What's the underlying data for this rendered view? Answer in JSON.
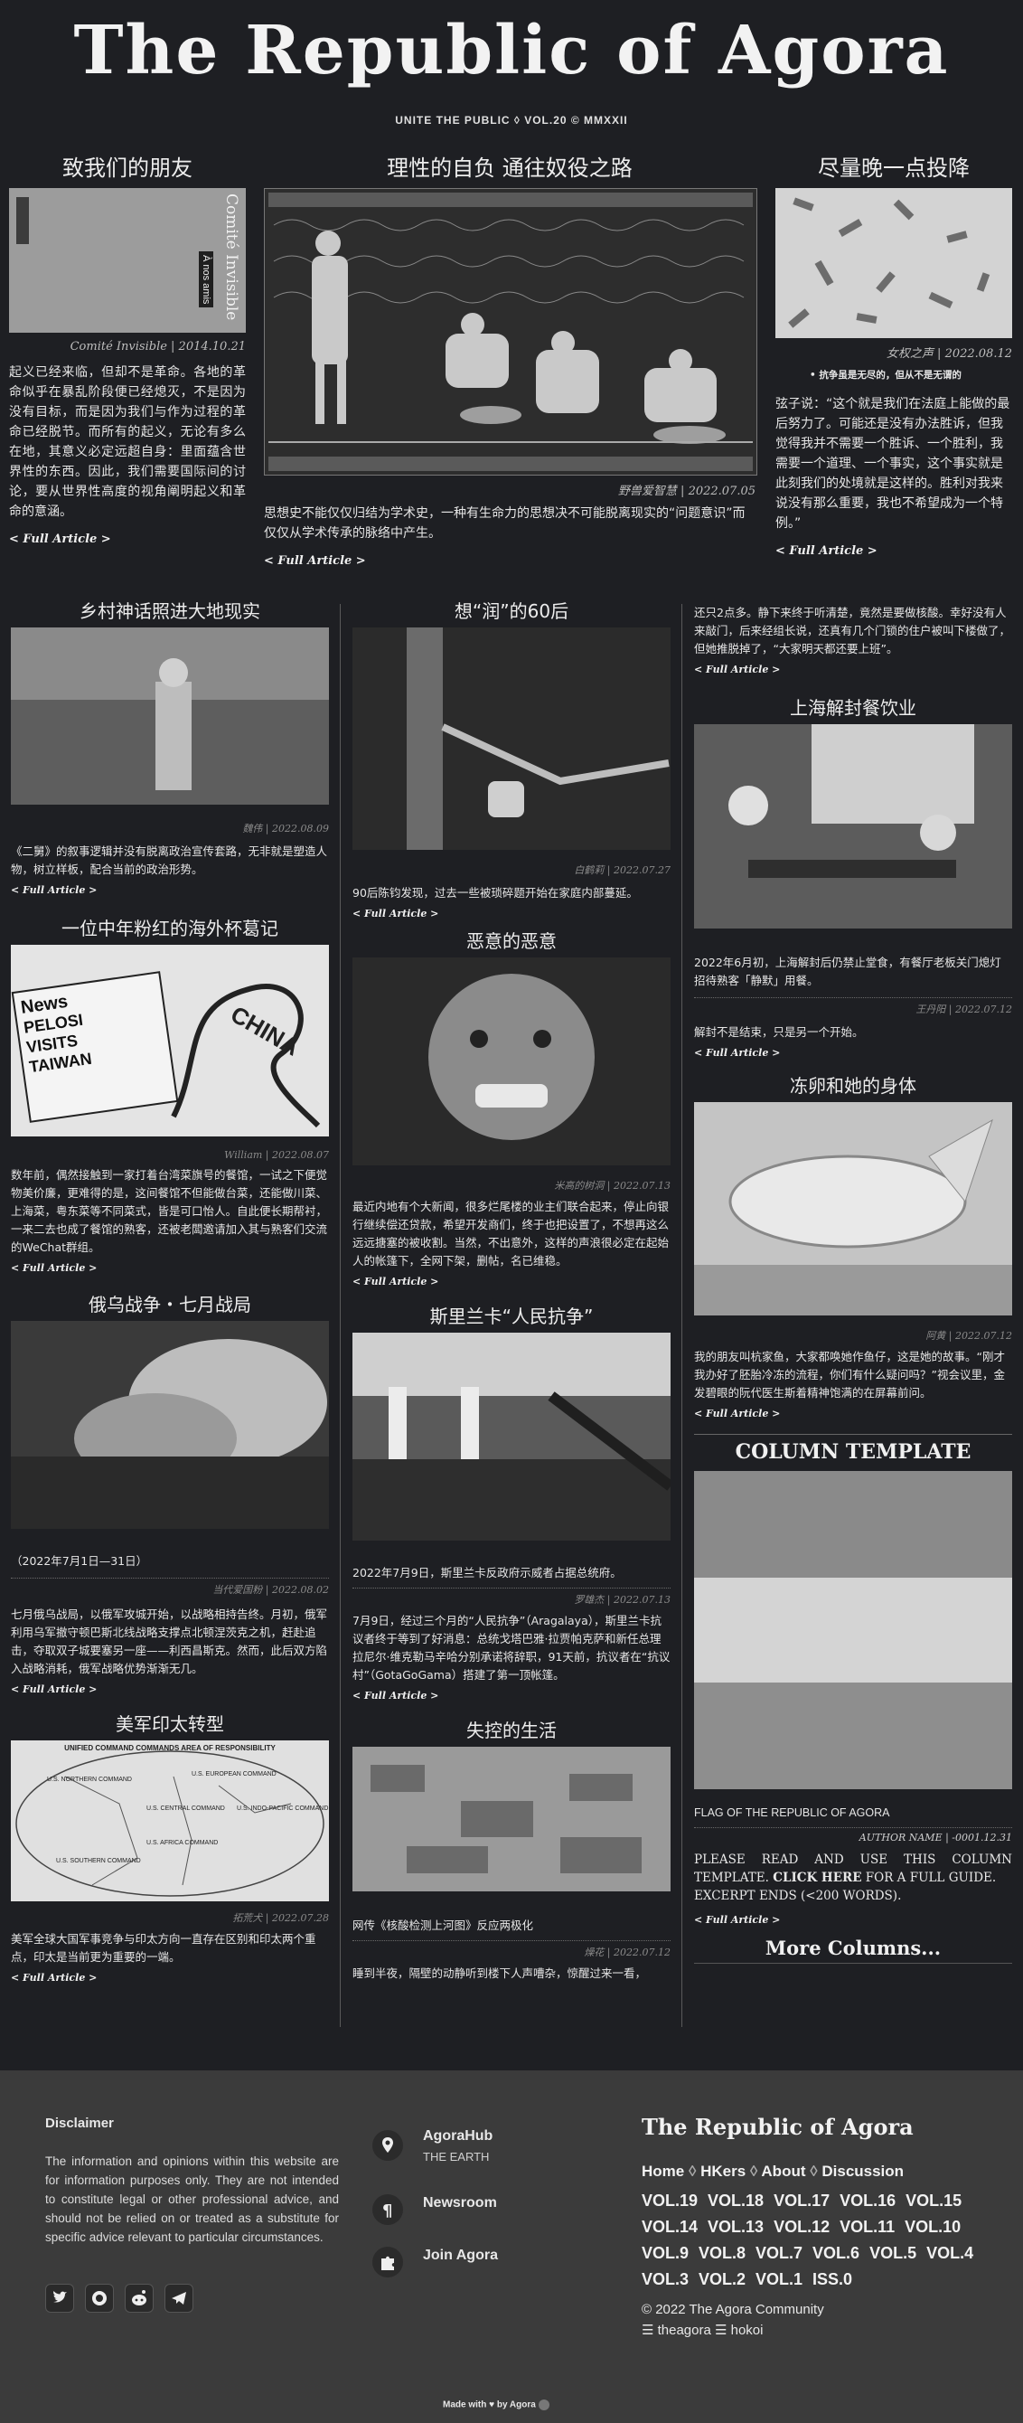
{
  "masthead": {
    "title": "The Republic of Agora",
    "subtitle": "UNITE THE PUBLIC ◊ VOL.20 © MMXXII"
  },
  "top": {
    "left": {
      "title": "致我们的朋友",
      "byline": "Comité Invisible | 2014.10.21",
      "body": "起义已经来临，但却不是革命。各地的革命似乎在暴乱阶段便已经熄灭，不是因为没有目标，而是因为我们与作为过程的革命已经脱节。而所有的起义，无论有多么在地，其意义必定远超自身：里面蕴含世界性的东西。因此，我们需要国际间的讨论，要从世界性高度的视角阐明起义和革命的意涵。",
      "cover_title": "Comité Invisible",
      "cover_small": "À nos amis"
    },
    "center": {
      "title": "理性的自负 通往奴役之路",
      "byline": "野兽爱智慧 | 2022.07.05",
      "body": "思想史不能仅仅归结为学术史，一种有生命力的思想决不可能脱离现实的“问题意识”而仅仅从学术传承的脉络中产生。"
    },
    "right": {
      "title": "尽量晚一点投降",
      "byline": "女权之声 | 2022.08.12",
      "bullet": "抗争虽是无尽的，但从不是无谓的",
      "body": "弦子说：“这个就是我们在法庭上能做的最后努力了。可能还是没有办法胜诉，但我觉得我并不需要一个胜诉、一个胜利，我需要一个道理、一个事实，这个事实就是此刻我们的处境就是这样的。胜利对我来说没有那么重要，我也不希望成为一个特例。”"
    },
    "more": "< Full Article >"
  },
  "col1": [
    {
      "title": "乡村神话照进大地现实",
      "byline": "魏伟 | 2022.08.09",
      "body": "《二舅》的叙事逻辑并没有脱离政治宣传套路，无非就是塑造人物，树立样板，配合当前的政治形势。"
    },
    {
      "title": "一位中年粉红的海外杯葛记",
      "byline": "William | 2022.08.07",
      "body": "数年前，偶然接触到一家打着台湾菜旗号的餐馆，一试之下便觉物美价廉，更难得的是，这间餐馆不但能做台菜，还能做川菜、上海菜，粤东菜等不同菜式，皆是可口怡人。自此便长期帮衬，一来二去也成了餐馆的熟客，还被老闆邀请加入其与熟客们交流的WeChat群组。",
      "news_a": "PELOSI",
      "news_b": "VISITS",
      "news_c": "TAIWAN",
      "news_d": "News",
      "news_e": "CHINA"
    },
    {
      "title": "俄乌战争・七月战局",
      "date_note": "（2022年7月1日—31日）",
      "byline": "当代爱国粉 | 2022.08.02",
      "body": "七月俄乌战局，以俄军攻城开始，以战略相持告终。月初，俄军利用乌军撤守顿巴斯北线战略支撑点北顿涅茨克之机，赶赴追击，夺取双子城要塞另一座——利西昌斯克。然而，此后双方陷入战略消耗，俄军战略优势渐渐无几。"
    },
    {
      "title": "美军印太转型",
      "byline": "拓荒犬 | 2022.07.28",
      "body": "美军全球大国军事竞争与印太方向一直存在区别和印太两个重点，印太是当前更为重要的一端。",
      "map_title": "UNIFIED COMMAND COMMANDS AREA OF RESPONSIBILITY",
      "map_labels": [
        "U.S. NORTHERN COMMAND",
        "U.S. EUROPEAN COMMAND",
        "U.S. INDO-PACIFIC COMMAND",
        "U.S. CENTRAL COMMAND",
        "U.S. AFRICA COMMAND",
        "U.S. SOUTHERN COMMAND"
      ]
    }
  ],
  "col2": [
    {
      "title": "想“润”的60后",
      "byline": "白鹤莉 | 2022.07.27",
      "body": "90后陈钧发现，过去一些被琐碎题开始在家庭内部蔓延。"
    },
    {
      "title": "恶意的恶意",
      "byline": "米高的树洞 | 2022.07.13",
      "body": "最近内地有个大新闻，很多烂尾楼的业主们联合起来，停止向银行继续偿还贷款，希望开发商们，终于也把设置了，不想再这么远远搪塞的被收割。当然，不出意外，这样的声浪很必定在起始人的帐篷下，全网下架，删帖，名已维稳。"
    },
    {
      "title": "斯里兰卡“人民抗争”",
      "lead": "2022年7月9日，斯里兰卡反政府示威者占据总统府。",
      "byline": "罗雄杰 | 2022.07.13",
      "body": "7月9日，经过三个月的“人民抗争”（Aragalaya），斯里兰卡抗议者终于等到了好消息：总统戈塔巴雅·拉贾帕克萨和新任总理拉尼尔·维克勒马辛哈分别承诺将辞职，91天前，抗议者在“抗议村”（GotaGoGama）搭建了第一顶帐篷。"
    },
    {
      "title": "失控的生活",
      "lead": "网传《核酸检测上河图》反应两极化",
      "byline": "燥花 | 2022.07.12",
      "body": "睡到半夜，隔壁的动静听到楼下人声嘈杂，惊醒过来一看，"
    }
  ],
  "col3": [
    {
      "title": "",
      "byline": "",
      "body": "还只2点多。静下来终于听清楚，竟然是要做核酸。幸好没有人来敲门，后来经组长说，还真有几个门锁的住户被叫下楼做了，但她推脱掉了，“大家明天都还要上班”。"
    },
    {
      "title": "上海解封餐饮业",
      "body": "2022年6月初，上海解封后仍禁止堂食，有餐厅老板关门熄灯招待熟客「静默」用餐。",
      "byline": "王丹阳 | 2022.07.12",
      "body2": "解封不是结束，只是另一个开始。"
    },
    {
      "title": "冻卵和她的身体",
      "byline": "阿黄 | 2022.07.12",
      "body": "我的朋友叫杭家鱼，大家都唤她作鱼仔，这是她的故事。“刚才我办好了胚胎冷冻的流程，你们有什么疑问吗？”视会议里，金发碧眼的阮代医生斯着精神饱满的在屏幕前问。"
    }
  ],
  "template": {
    "title": "COLUMN TEMPLATE",
    "caption": "FLAG OF THE REPUBLIC OF AGORA",
    "byline": "AUTHOR NAME | -0001.12.31",
    "text_a": "PLEASE READ AND USE THIS COLUMN TEMPLATE.",
    "text_b": "CLICK HERE",
    "text_c": "FOR A FULL GUIDE.",
    "text_d": "EXCERPT ENDS (<200 WORDS).",
    "more_columns": "More Columns...",
    "flag_colors": [
      "#8a8a8a",
      "#d4d4d4",
      "#8e8e8e"
    ]
  },
  "footer": {
    "disclaimer_title": "Disclaimer",
    "disclaimer": "The information and opinions within this website are for information purposes only. They are not intended to constitute legal or other professional advice, and should not be relied on or treated as a substitute for specific advice relevant to particular circumstances.",
    "links": [
      {
        "label": "AgoraHub",
        "sub": "THE EARTH",
        "icon": "location-pin-icon"
      },
      {
        "label": "Newsroom",
        "sub": "",
        "icon": "pilcrow-icon"
      },
      {
        "label": "Join Agora",
        "sub": "",
        "icon": "puzzle-icon"
      }
    ],
    "brand": "The Republic of Agora",
    "nav": [
      "Home",
      "HKers",
      "About",
      "Discussion"
    ],
    "vols": [
      [
        "VOL.19",
        "VOL.18",
        "VOL.17",
        "VOL.16",
        "VOL.15"
      ],
      [
        "VOL.14",
        "VOL.13",
        "VOL.12",
        "VOL.11",
        "VOL.10"
      ],
      [
        "VOL.9",
        "VOL.8",
        "VOL.7",
        "VOL.6",
        "VOL.5",
        "VOL.4"
      ],
      [
        "VOL.3",
        "VOL.2",
        "VOL.1",
        "ISS.0"
      ]
    ],
    "copyright": "© 2022 The Agora Community",
    "credits": "☰ theagora ☰ hokoi",
    "made_with": "Made with ♥ by Agora",
    "social": [
      "twitter-icon",
      "github-icon",
      "reddit-icon",
      "telegram-icon"
    ]
  }
}
